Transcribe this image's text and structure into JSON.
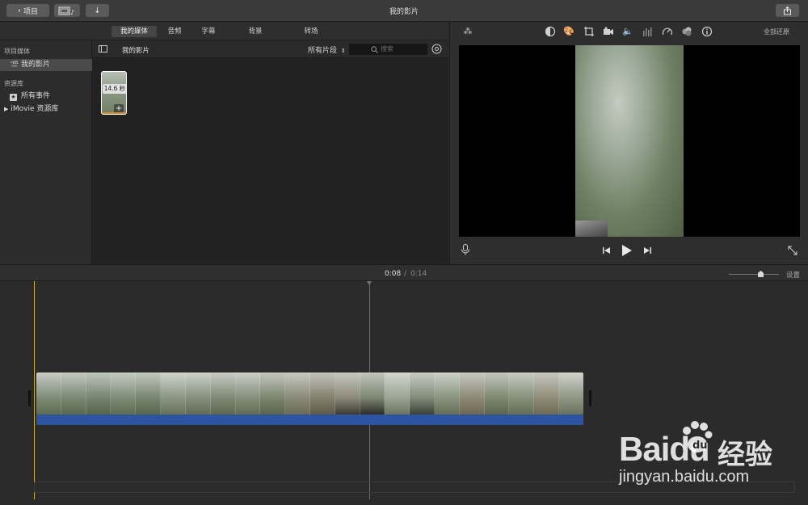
{
  "titlebar": {
    "back_label": "项目",
    "window_title": "我的影片",
    "share_icon": "share-icon"
  },
  "media_tabs": [
    {
      "label": "我的媒体",
      "active": true
    },
    {
      "label": "音频",
      "active": false
    },
    {
      "label": "字幕",
      "active": false
    },
    {
      "label": "背景",
      "active": false
    },
    {
      "label": "转场",
      "active": false
    }
  ],
  "sidebar": {
    "project_media_header": "项目媒体",
    "project_item": "我的影片",
    "library_header": "资源库",
    "all_events": "所有事件",
    "imovie_library": "iMovie 资源库"
  },
  "browser": {
    "title": "我的影片",
    "filter_label": "所有片段",
    "search_placeholder": "搜索",
    "clip": {
      "duration": "14.6 秒"
    }
  },
  "viewer": {
    "reset_all": "全部还原"
  },
  "timeline": {
    "current_time": "0:08",
    "separator": "/",
    "total_time": "0:14",
    "settings_label": "设置"
  },
  "watermark": {
    "brand": "Baidu",
    "brand_cn": "经验",
    "url": "jingyan.baidu.com"
  },
  "colors": {
    "audio_bar": "#2e53a0",
    "playhead": "#c9b232",
    "clip_marker": "#e08a2b"
  }
}
